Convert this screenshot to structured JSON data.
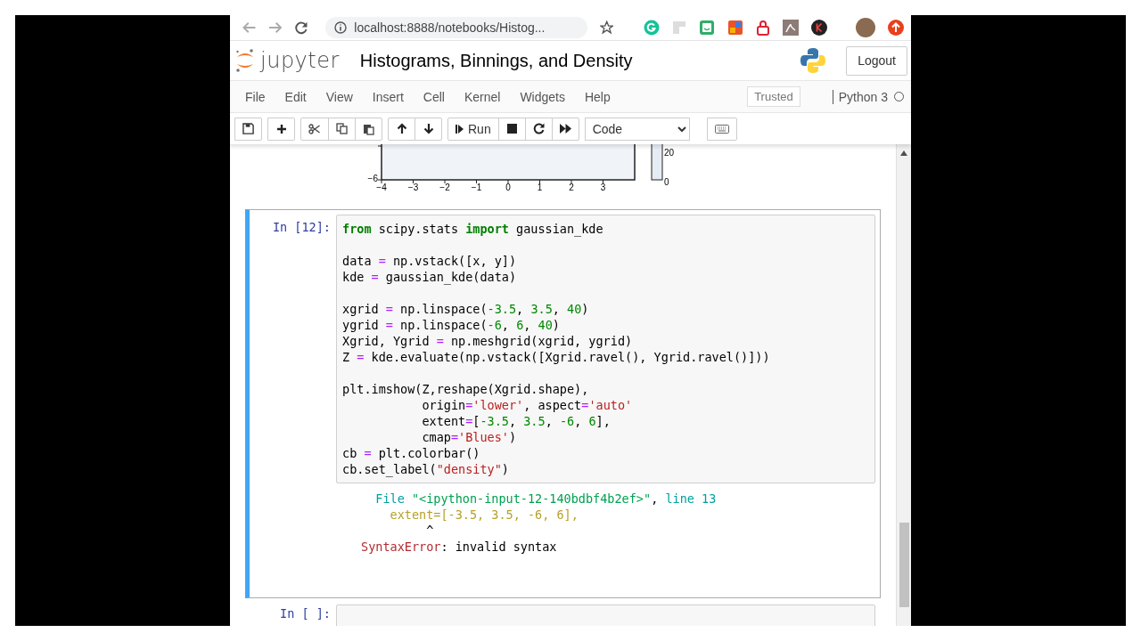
{
  "browser": {
    "address": "localhost:8888/notebooks/Histog..."
  },
  "header": {
    "logo_text": "jupyter",
    "notebook_title": "Histograms, Binnings, and Density",
    "logout_label": "Logout"
  },
  "menubar": {
    "items": [
      "File",
      "Edit",
      "View",
      "Insert",
      "Cell",
      "Kernel",
      "Widgets",
      "Help"
    ],
    "trusted_label": "Trusted",
    "kernel": {
      "name": "Python 3",
      "busy": false
    }
  },
  "toolbar": {
    "groups": [
      [
        {
          "kind": "save"
        }
      ],
      [
        {
          "kind": "add"
        }
      ],
      [
        {
          "kind": "cut"
        },
        {
          "kind": "copy"
        },
        {
          "kind": "paste"
        }
      ],
      [
        {
          "kind": "up"
        },
        {
          "kind": "down"
        }
      ],
      [
        {
          "kind": "run",
          "label": "Run"
        },
        {
          "kind": "stop"
        },
        {
          "kind": "restart"
        },
        {
          "kind": "fastforward"
        }
      ]
    ],
    "cell_type": "Code",
    "extra_groups": [
      [
        {
          "kind": "keyboard"
        }
      ]
    ]
  },
  "plot_fragment": {
    "x_tick_labels": [
      "−4",
      "−3",
      "−2",
      "−1",
      "0",
      "1",
      "2",
      "3"
    ],
    "y_tick_labels": [
      "−6"
    ],
    "colorbar_tick_labels": [
      "20",
      "0"
    ]
  },
  "cells": [
    {
      "prompt": "In [12]:",
      "selected": true,
      "code_blocks": [
        [
          [
            {
              "kind": "kw",
              "text": "from"
            },
            {
              "kind": "plain",
              "text": " scipy.stats "
            },
            {
              "kind": "kw",
              "text": "import"
            },
            {
              "kind": "plain",
              "text": " gaussian_kde"
            }
          ]
        ],
        [
          [
            {
              "kind": "plain",
              "text": "data "
            },
            {
              "kind": "op",
              "text": "="
            },
            {
              "kind": "plain",
              "text": " np.vstack([x, y])"
            }
          ],
          [
            {
              "kind": "plain",
              "text": "kde "
            },
            {
              "kind": "op",
              "text": "="
            },
            {
              "kind": "plain",
              "text": " gaussian_kde(data)"
            }
          ]
        ],
        [
          [
            {
              "kind": "plain",
              "text": "xgrid "
            },
            {
              "kind": "op",
              "text": "="
            },
            {
              "kind": "plain",
              "text": " np.linspace("
            },
            {
              "kind": "num",
              "text": "-3.5"
            },
            {
              "kind": "plain",
              "text": ", "
            },
            {
              "kind": "num",
              "text": "3.5"
            },
            {
              "kind": "plain",
              "text": ", "
            },
            {
              "kind": "num",
              "text": "40"
            },
            {
              "kind": "plain",
              "text": ")"
            }
          ],
          [
            {
              "kind": "plain",
              "text": "ygrid "
            },
            {
              "kind": "op",
              "text": "="
            },
            {
              "kind": "plain",
              "text": " np.linspace("
            },
            {
              "kind": "num",
              "text": "-6"
            },
            {
              "kind": "plain",
              "text": ", "
            },
            {
              "kind": "num",
              "text": "6"
            },
            {
              "kind": "plain",
              "text": ", "
            },
            {
              "kind": "num",
              "text": "40"
            },
            {
              "kind": "plain",
              "text": ")"
            }
          ],
          [
            {
              "kind": "plain",
              "text": "Xgrid, Ygrid "
            },
            {
              "kind": "op",
              "text": "="
            },
            {
              "kind": "plain",
              "text": " np.meshgrid(xgrid, ygrid)"
            }
          ],
          [
            {
              "kind": "plain",
              "text": "Z "
            },
            {
              "kind": "op",
              "text": "="
            },
            {
              "kind": "plain",
              "text": " kde.evaluate(np.vstack([Xgrid.ravel(), Ygrid.ravel()]))"
            }
          ]
        ],
        [
          [
            {
              "kind": "plain",
              "text": "plt.imshow(Z,reshape(Xgrid.shape),"
            }
          ],
          [
            {
              "kind": "plain",
              "text": "           origin"
            },
            {
              "kind": "op",
              "text": "="
            },
            {
              "kind": "str",
              "text": "'lower'"
            },
            {
              "kind": "plain",
              "text": ", aspect"
            },
            {
              "kind": "op",
              "text": "="
            },
            {
              "kind": "str",
              "text": "'auto'"
            }
          ],
          [
            {
              "kind": "plain",
              "text": "           extent"
            },
            {
              "kind": "op",
              "text": "="
            },
            {
              "kind": "plain",
              "text": "["
            },
            {
              "kind": "num",
              "text": "-3.5"
            },
            {
              "kind": "plain",
              "text": ", "
            },
            {
              "kind": "num",
              "text": "3.5"
            },
            {
              "kind": "plain",
              "text": ", "
            },
            {
              "kind": "num",
              "text": "-6"
            },
            {
              "kind": "plain",
              "text": ", "
            },
            {
              "kind": "num",
              "text": "6"
            },
            {
              "kind": "plain",
              "text": "],"
            }
          ],
          [
            {
              "kind": "plain",
              "text": "           cmap"
            },
            {
              "kind": "op",
              "text": "="
            },
            {
              "kind": "str",
              "text": "'Blues'"
            },
            {
              "kind": "plain",
              "text": ")"
            }
          ],
          [
            {
              "kind": "plain",
              "text": "cb "
            },
            {
              "kind": "op",
              "text": "="
            },
            {
              "kind": "plain",
              "text": " plt.colorbar()"
            }
          ],
          [
            {
              "kind": "plain",
              "text": "cb.set_label("
            },
            {
              "kind": "str",
              "text": "\"density\""
            },
            {
              "kind": "plain",
              "text": ")"
            }
          ]
        ]
      ],
      "output": [
        [
          {
            "kind": "tb_cyan",
            "text": "  File "
          },
          {
            "kind": "tb_green",
            "text": "\"<ipython-input-12-140bdbf4b2ef>\""
          },
          {
            "kind": "plain",
            "text": ", "
          },
          {
            "kind": "tb_cyan",
            "text": "line 13"
          }
        ],
        [
          {
            "kind": "tb_yellow",
            "text": "    extent=[-3.5, 3.5, -6, 6],"
          }
        ],
        [
          {
            "kind": "plain",
            "text": "         ^"
          }
        ],
        [
          {
            "kind": "tb_red",
            "text": "SyntaxError"
          },
          {
            "kind": "plain",
            "text": ": invalid syntax"
          }
        ]
      ]
    },
    {
      "prompt": "In [ ]:",
      "selected": false
    }
  ]
}
